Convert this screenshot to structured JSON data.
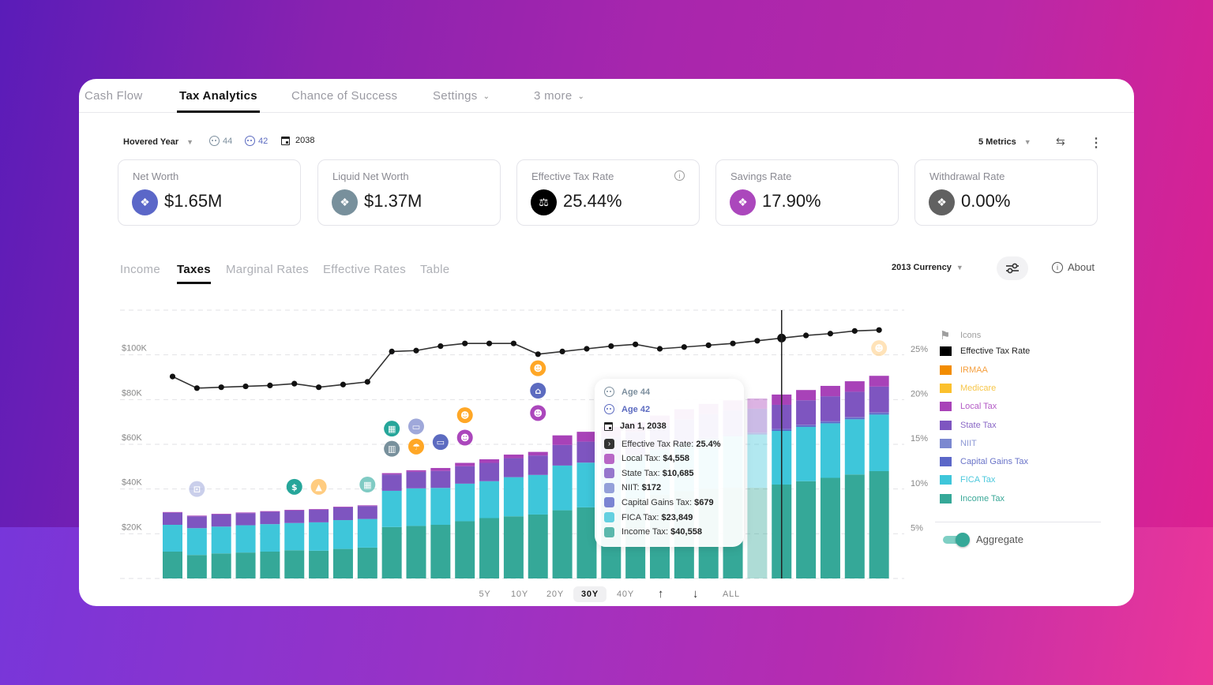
{
  "colors": {
    "income": "#35a898",
    "fica": "#3ec6da",
    "capital_gains": "#5b67c8",
    "niit": "#7b88d0",
    "state": "#7e55c0",
    "local": "#a842b8",
    "medicare": "#fbc02d",
    "irmaa": "#f28c00",
    "effective_rate": "#111111"
  },
  "top_nav": {
    "tabs": [
      {
        "label": "Cash Flow",
        "active": false
      },
      {
        "label": "Tax Analytics",
        "active": true
      },
      {
        "label": "Chance of Success",
        "active": false
      },
      {
        "label": "Settings",
        "active": false,
        "dropdown": true
      },
      {
        "label": "3 more",
        "active": false,
        "dropdown": true
      }
    ]
  },
  "controls": {
    "hovered_year_label": "Hovered Year",
    "age_1": "44",
    "age_2": "42",
    "year": "2038",
    "metrics_label": "5 Metrics"
  },
  "metrics": [
    {
      "label": "Net Worth",
      "value": "$1.65M",
      "icon": "chart-icon",
      "color": "#5b67c8"
    },
    {
      "label": "Liquid Net Worth",
      "value": "$1.37M",
      "icon": "chart-icon",
      "color": "#78909c"
    },
    {
      "label": "Effective Tax Rate",
      "value": "25.44%",
      "icon": "scale-icon",
      "color": "#000000",
      "info": true
    },
    {
      "label": "Savings Rate",
      "value": "17.90%",
      "icon": "chart-icon",
      "color": "#ab47bc"
    },
    {
      "label": "Withdrawal Rate",
      "value": "0.00%",
      "icon": "chart-icon",
      "color": "#616161"
    }
  ],
  "sub_tabs": [
    {
      "label": "Income",
      "active": false
    },
    {
      "label": "Taxes",
      "active": true
    },
    {
      "label": "Marginal Rates",
      "active": false
    },
    {
      "label": "Effective Rates",
      "active": false
    },
    {
      "label": "Table",
      "active": false
    }
  ],
  "currency_label": "2013 Currency",
  "about_label": "About",
  "legend": {
    "items": [
      {
        "label": "Icons",
        "key": "icons",
        "color": "#9e9e9e",
        "text_color": "#9e9e9e"
      },
      {
        "label": "Effective Tax Rate",
        "key": "effective_rate",
        "color": "#000000",
        "text_color": "#222222"
      },
      {
        "label": "IRMAA",
        "key": "irmaa",
        "color": "#f28c00",
        "text_color": "#f5a040"
      },
      {
        "label": "Medicare",
        "key": "medicare",
        "color": "#fbc02d",
        "text_color": "#f7c64a"
      },
      {
        "label": "Local Tax",
        "key": "local",
        "color": "#a842b8",
        "text_color": "#b45cc6"
      },
      {
        "label": "State Tax",
        "key": "state",
        "color": "#7e55c0",
        "text_color": "#8a68c6"
      },
      {
        "label": "NIIT",
        "key": "niit",
        "color": "#7b88d0",
        "text_color": "#8f9ad6"
      },
      {
        "label": "Capital Gains Tax",
        "key": "capital_gains",
        "color": "#5b67c8",
        "text_color": "#6a74c8"
      },
      {
        "label": "FICA Tax",
        "key": "fica",
        "color": "#3ec6da",
        "text_color": "#4cc8dc"
      },
      {
        "label": "Income Tax",
        "key": "income",
        "color": "#35a898",
        "text_color": "#3aa898"
      }
    ],
    "aggregate_label": "Aggregate",
    "aggregate_on": true
  },
  "tooltip": {
    "age_1": "Age 44",
    "age_2": "Age 42",
    "date": "Jan 1, 2038",
    "rows": [
      {
        "label": "Effective Tax Rate:",
        "value": "25.4%",
        "key": "effective_rate"
      },
      {
        "label": "Local Tax:",
        "value": "$4,558",
        "key": "local"
      },
      {
        "label": "State Tax:",
        "value": "$10,685",
        "key": "state"
      },
      {
        "label": "NIIT:",
        "value": "$172",
        "key": "niit"
      },
      {
        "label": "Capital Gains Tax:",
        "value": "$679",
        "key": "capital_gains"
      },
      {
        "label": "FICA Tax:",
        "value": "$23,849",
        "key": "fica"
      },
      {
        "label": "Income Tax:",
        "value": "$40,558",
        "key": "income"
      }
    ]
  },
  "range_buttons": [
    {
      "label": "5Y",
      "active": false
    },
    {
      "label": "10Y",
      "active": false
    },
    {
      "label": "20Y",
      "active": false
    },
    {
      "label": "30Y",
      "active": true
    },
    {
      "label": "40Y",
      "active": false
    },
    {
      "label": "↑",
      "active": false,
      "name": "scroll-up"
    },
    {
      "label": "↓",
      "active": false,
      "name": "scroll-down"
    },
    {
      "label": "ALL",
      "active": false
    }
  ],
  "chart_data": {
    "type": "bar",
    "stacked": true,
    "hovered_index": 24,
    "x_count": 31,
    "left_axis": {
      "ticks": [
        "$20K",
        "$40K",
        "$60K",
        "$80K",
        "$100K"
      ],
      "tick_values": [
        20000,
        40000,
        60000,
        80000,
        100000
      ],
      "range": [
        0,
        120000
      ]
    },
    "right_axis": {
      "ticks": [
        "5%",
        "10%",
        "15%",
        "20%",
        "25%"
      ],
      "tick_values": [
        5,
        10,
        15,
        20,
        25
      ],
      "range": [
        0,
        30
      ]
    },
    "series": [
      {
        "name": "Income Tax",
        "key": "income",
        "values": [
          12000,
          10500,
          11200,
          11600,
          12000,
          12600,
          12400,
          13200,
          13800,
          23000,
          23500,
          24000,
          25600,
          27000,
          27800,
          28600,
          30500,
          31800,
          33000,
          36000,
          37500,
          39000,
          40200,
          40558,
          40558,
          42000,
          43500,
          45000,
          46500,
          48000
        ]
      },
      {
        "name": "FICA Tax",
        "key": "fica",
        "values": [
          12000,
          12000,
          12000,
          12200,
          12300,
          12200,
          12700,
          12900,
          12800,
          16200,
          16800,
          16500,
          16800,
          16500,
          17500,
          17700,
          20000,
          20000,
          20000,
          18800,
          20000,
          21000,
          22000,
          23000,
          23849,
          24000,
          24300,
          24400,
          24700,
          25300
        ]
      },
      {
        "name": "Capital Gains Tax",
        "key": "capital_gains",
        "values": [
          0,
          0,
          0,
          0,
          0,
          0,
          0,
          0,
          0,
          0,
          0,
          0,
          0,
          0,
          0,
          0,
          0,
          0,
          300,
          400,
          500,
          600,
          650,
          679,
          679,
          680,
          700,
          700,
          720,
          740
        ]
      },
      {
        "name": "NIIT",
        "key": "niit",
        "values": [
          0,
          0,
          0,
          0,
          0,
          0,
          0,
          0,
          0,
          0,
          0,
          0,
          0,
          0,
          0,
          0,
          0,
          0,
          150,
          160,
          165,
          170,
          172,
          172,
          172,
          175,
          180,
          180,
          185,
          190
        ]
      },
      {
        "name": "State Tax",
        "key": "state",
        "values": [
          5400,
          5300,
          5400,
          5400,
          5500,
          5600,
          5600,
          5700,
          5800,
          7300,
          7400,
          7600,
          7800,
          8200,
          8500,
          8700,
          9200,
          9400,
          9800,
          10000,
          10200,
          10400,
          10500,
          10685,
          10685,
          10800,
          11000,
          11200,
          11400,
          11600
        ]
      },
      {
        "name": "Local Tax",
        "key": "local",
        "values": [
          300,
          300,
          300,
          300,
          300,
          300,
          300,
          300,
          300,
          600,
          700,
          1300,
          1500,
          1600,
          1600,
          1600,
          4300,
          4400,
          4500,
          4500,
          4500,
          4550,
          4550,
          4558,
          4558,
          4600,
          4600,
          4650,
          4700,
          4800
        ]
      }
    ],
    "effective_rate": {
      "name": "Effective Tax Rate",
      "values": [
        21.9,
        20.6,
        20.7,
        20.8,
        20.9,
        21.1,
        20.7,
        21.0,
        21.3,
        24.7,
        24.8,
        25.3,
        25.6,
        25.6,
        25.6,
        24.4,
        24.7,
        25.0,
        25.3,
        25.5,
        25.0,
        25.2,
        25.4,
        25.6,
        25.9,
        26.2,
        26.5,
        26.7,
        27.0,
        27.1
      ]
    },
    "event_icons": [
      {
        "bar": 1,
        "value": 40000,
        "icon": "luggage-icon",
        "color": "#9fa8da",
        "faded": true
      },
      {
        "bar": 5,
        "value": 41000,
        "icon": "dollar-icon",
        "color": "#26a69a"
      },
      {
        "bar": 6,
        "value": 41000,
        "icon": "graduation-icon",
        "color": "#ffcc80"
      },
      {
        "bar": 8,
        "value": 42000,
        "icon": "building-icon",
        "color": "#80cbc4"
      },
      {
        "bar": 9,
        "value": 67000,
        "icon": "building-icon",
        "color": "#26a69a"
      },
      {
        "bar": 9,
        "value": 58000,
        "icon": "city-icon",
        "color": "#78909c"
      },
      {
        "bar": 10,
        "value": 68000,
        "icon": "car-icon",
        "color": "#9fa8da"
      },
      {
        "bar": 10,
        "value": 59000,
        "icon": "beach-icon",
        "color": "#ffa726"
      },
      {
        "bar": 11,
        "value": 61000,
        "icon": "car-icon",
        "color": "#5c6bc0"
      },
      {
        "bar": 12,
        "value": 73000,
        "icon": "child-icon",
        "color": "#ffa726"
      },
      {
        "bar": 12,
        "value": 63000,
        "icon": "child-icon",
        "color": "#ab47bc"
      },
      {
        "bar": 15,
        "value": 94000,
        "icon": "child-icon",
        "color": "#ffa726"
      },
      {
        "bar": 15,
        "value": 84000,
        "icon": "house-icon",
        "color": "#5c6bc0"
      },
      {
        "bar": 15,
        "value": 74000,
        "icon": "child-icon",
        "color": "#ab47bc"
      },
      {
        "bar": 18,
        "value": 77000,
        "icon": "luggage-icon",
        "color": "#9fa8da",
        "faded": true
      },
      {
        "bar": 29,
        "value": 103000,
        "icon": "child-icon",
        "color": "#ffcc80",
        "faded": true
      }
    ]
  }
}
